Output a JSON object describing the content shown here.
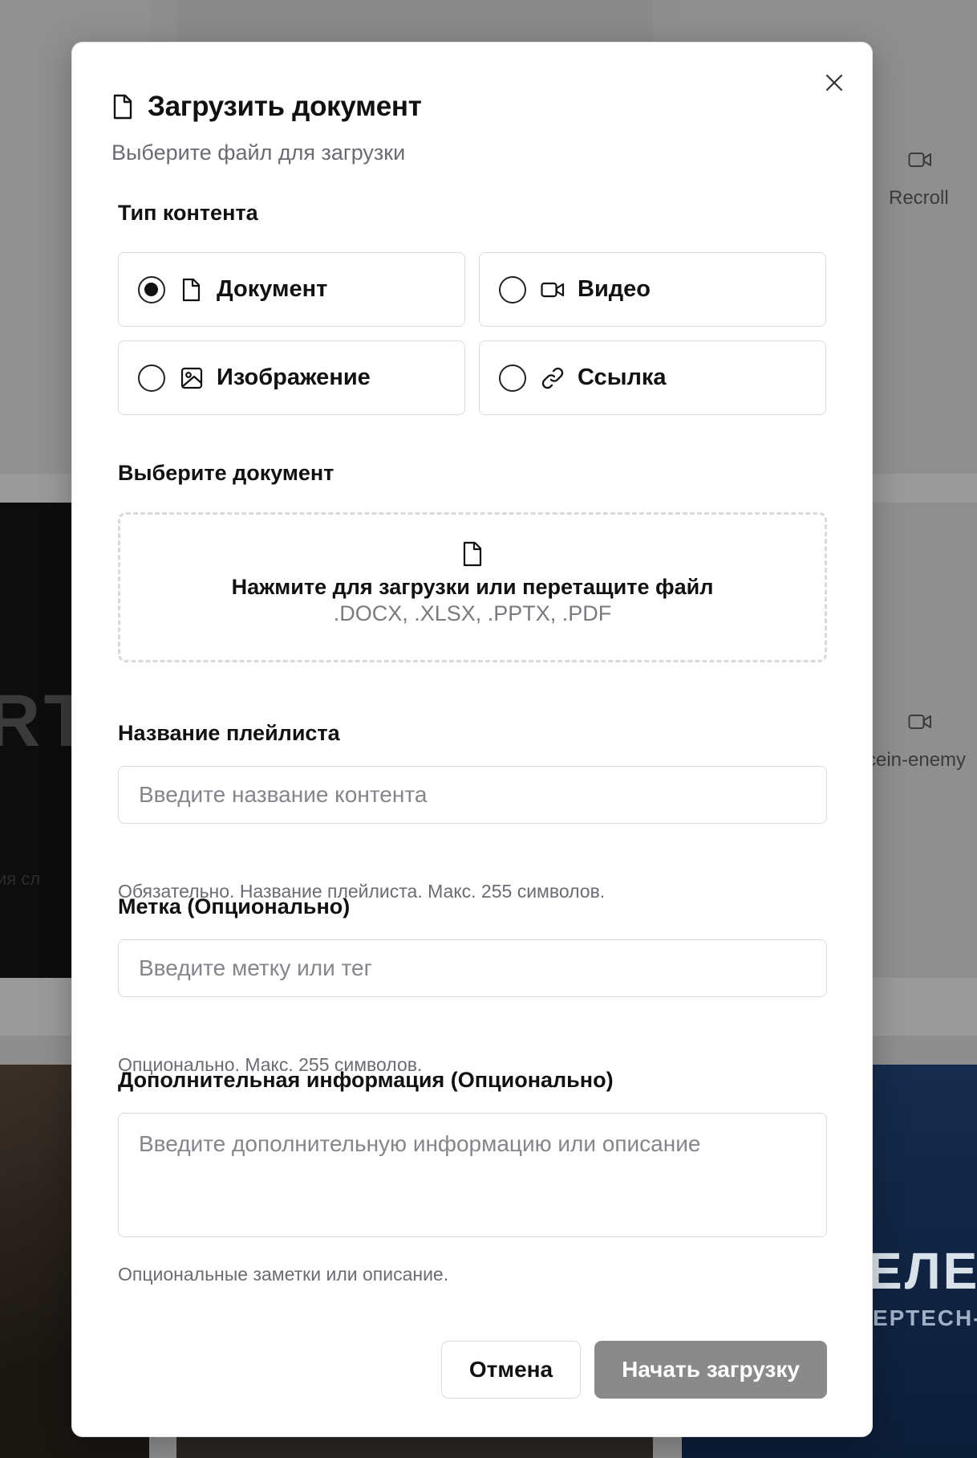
{
  "background": {
    "card_label_1": "Recroll",
    "card_label_2": "rcein-enemy",
    "card_big_text": "RT",
    "card_small_text": "ия сл",
    "card_blue_text": "ЕЛЕ",
    "card_blue_sub": "ЕРТЕСН-",
    "video_icon": "video-icon"
  },
  "modal": {
    "title": "Загрузить документ",
    "title_icon": "document-icon",
    "subtitle": "Выберите файл для загрузки",
    "close_icon": "close-icon"
  },
  "content_type": {
    "label": "Тип контента",
    "options": [
      {
        "label": "Документ",
        "icon": "document-icon",
        "selected": true
      },
      {
        "label": "Видео",
        "icon": "video-icon",
        "selected": false
      },
      {
        "label": "Изображение",
        "icon": "image-icon",
        "selected": false
      },
      {
        "label": "Ссылка",
        "icon": "link-icon",
        "selected": false
      }
    ]
  },
  "file_select": {
    "label": "Выберите документ",
    "dropzone_title": "Нажмите для загрузки или перетащите файл",
    "dropzone_formats": ".DOCX, .XLSX, .PPTX, .PDF",
    "icon": "document-icon"
  },
  "playlist_name": {
    "label": "Название плейлиста",
    "placeholder": "Введите название контента",
    "value": "",
    "helper": "Обязательно. Название плейлиста. Макс. 255 символов."
  },
  "tag": {
    "label": "Метка (Опционально)",
    "placeholder": "Введите метку или тег",
    "value": "",
    "helper": "Опционально. Макс. 255 символов."
  },
  "extra_info": {
    "label": "Дополнительная информация (Опционально)",
    "placeholder": "Введите дополнительную информацию или описание",
    "value": "",
    "helper": "Опциональные заметки или описание."
  },
  "actions": {
    "cancel_label": "Отмена",
    "submit_label": "Начать загрузку",
    "submit_disabled": true
  },
  "colors": {
    "accent": "#111111",
    "disabled_button": "#8a8a8a",
    "border": "#dcdce0",
    "muted_text": "#6b6b73"
  }
}
